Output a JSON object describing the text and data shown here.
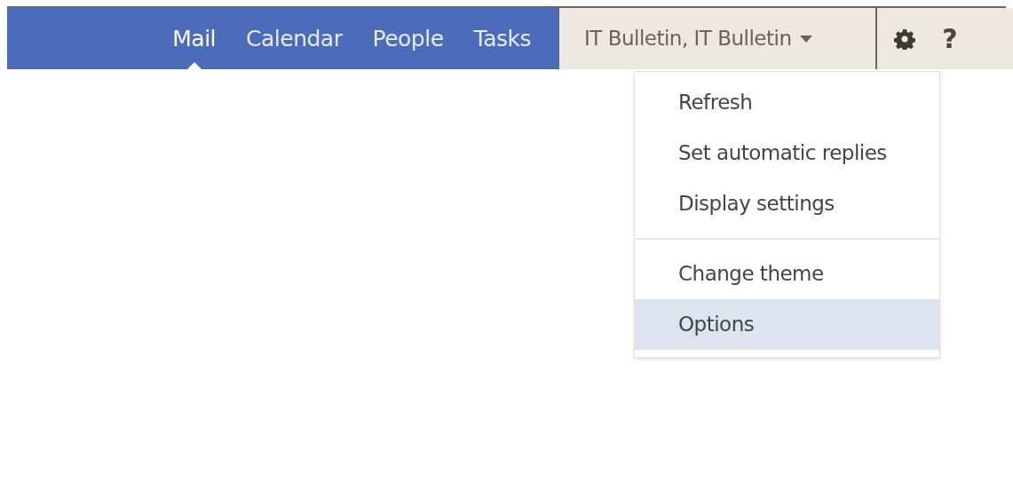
{
  "nav": {
    "tabs": [
      {
        "label": "Mail",
        "selected": true
      },
      {
        "label": "Calendar",
        "selected": false
      },
      {
        "label": "People",
        "selected": false
      },
      {
        "label": "Tasks",
        "selected": false
      }
    ],
    "account": {
      "label": "IT Bulletin, IT Bulletin",
      "expanded": true
    },
    "help": {
      "label": "?"
    }
  },
  "settings_menu": {
    "sections": [
      {
        "items": [
          {
            "label": "Refresh",
            "selected": false
          },
          {
            "label": "Set automatic replies",
            "selected": false
          },
          {
            "label": "Display settings",
            "selected": false
          }
        ]
      },
      {
        "items": [
          {
            "label": "Change theme",
            "selected": false
          },
          {
            "label": "Options",
            "selected": true
          }
        ]
      }
    ]
  }
}
